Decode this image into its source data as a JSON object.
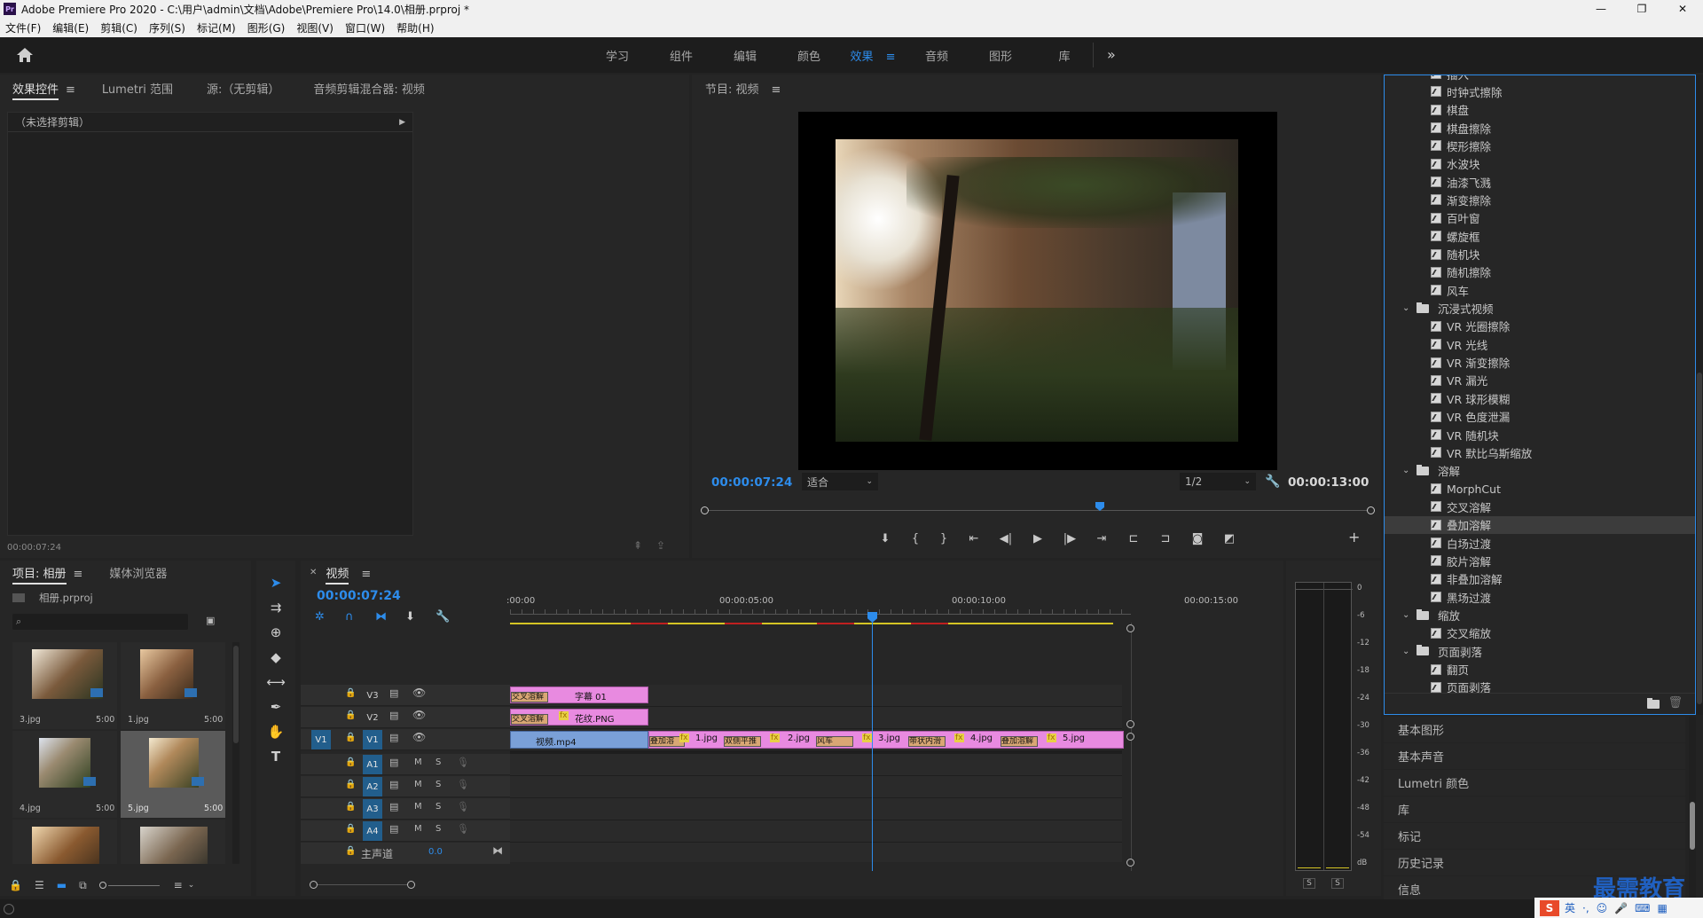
{
  "window": {
    "title": "Adobe Premiere Pro 2020 - C:\\用户\\admin\\文档\\Adobe\\Premiere Pro\\14.0\\相册.prproj *",
    "controls": [
      "—",
      "❐",
      "✕"
    ]
  },
  "menubar": [
    "文件(F)",
    "编辑(E)",
    "剪辑(C)",
    "序列(S)",
    "标记(M)",
    "图形(G)",
    "视图(V)",
    "窗口(W)",
    "帮助(H)"
  ],
  "workspaces": {
    "tabs": [
      "学习",
      "组件",
      "编辑",
      "颜色",
      "效果",
      "音频",
      "图形",
      "库"
    ],
    "active": "效果",
    "more": "»"
  },
  "effect_controls": {
    "tabs": [
      "效果控件",
      "Lumetri 范围",
      "源:（无剪辑）",
      "音频剪辑混合器: 视频"
    ],
    "no_clip": "（未选择剪辑）",
    "timecode": "00:00:07:24"
  },
  "program": {
    "title": "节目: 视频",
    "timecode": "00:00:07:24",
    "fit": "适合",
    "resolution": "1/2",
    "duration": "00:00:13:00"
  },
  "project": {
    "tabs": [
      "项目: 相册",
      "媒体浏览器"
    ],
    "file": "相册.prproj",
    "search_placeholder": "",
    "items": [
      {
        "name": "3.jpg",
        "duration": "5:00"
      },
      {
        "name": "1.jpg",
        "duration": "5:00"
      },
      {
        "name": "4.jpg",
        "duration": "5:00"
      },
      {
        "name": "5.jpg",
        "duration": "5:00"
      }
    ]
  },
  "timeline": {
    "tab": "视频",
    "timecode": "00:00:07:24",
    "ruler": [
      ":00:00",
      "00:00:05:00",
      "00:00:10:00",
      "00:00:15:00"
    ],
    "video_tracks": [
      {
        "name": "V3",
        "target": ""
      },
      {
        "name": "V2",
        "target": ""
      },
      {
        "name": "V1",
        "target": "V1"
      }
    ],
    "audio_tracks": [
      "A1",
      "A2",
      "A3",
      "A4"
    ],
    "master_label": "主声道",
    "master_value": "0.0",
    "mute": "M",
    "solo": "S",
    "clips": {
      "v3": [
        {
          "label": "交叉溶解"
        },
        {
          "label": "字幕 01"
        }
      ],
      "v2": [
        {
          "label": "交叉溶解"
        },
        {
          "label": "花纹.PNG"
        }
      ],
      "v1": [
        {
          "label": "视频.mp4"
        },
        {
          "label": "叠加溶"
        },
        {
          "label": "1.jpg"
        },
        {
          "label": "双侧平推"
        },
        {
          "label": "2.jpg"
        },
        {
          "label": "风车"
        },
        {
          "label": "3.jpg"
        },
        {
          "label": "带状内滑"
        },
        {
          "label": "4.jpg"
        },
        {
          "label": "叠加溶解"
        },
        {
          "label": "5.jpg"
        }
      ],
      "fx": "fx"
    }
  },
  "meter": {
    "scale": [
      "0",
      "-6",
      "-12",
      "-18",
      "-24",
      "-30",
      "-36",
      "-42",
      "-48",
      "-54",
      "dB"
    ],
    "solo_labels": [
      "S",
      "S"
    ]
  },
  "effects_tree": {
    "items": [
      {
        "kind": "effect",
        "label": "插入"
      },
      {
        "kind": "effect",
        "label": "时钟式擦除"
      },
      {
        "kind": "effect",
        "label": "棋盘"
      },
      {
        "kind": "effect",
        "label": "棋盘擦除"
      },
      {
        "kind": "effect",
        "label": "楔形擦除"
      },
      {
        "kind": "effect",
        "label": "水波块"
      },
      {
        "kind": "effect",
        "label": "油漆飞溅"
      },
      {
        "kind": "effect",
        "label": "渐变擦除"
      },
      {
        "kind": "effect",
        "label": "百叶窗"
      },
      {
        "kind": "effect",
        "label": "螺旋框"
      },
      {
        "kind": "effect",
        "label": "随机块"
      },
      {
        "kind": "effect",
        "label": "随机擦除"
      },
      {
        "kind": "effect",
        "label": "风车"
      },
      {
        "kind": "folder",
        "label": "沉浸式视频"
      },
      {
        "kind": "effect",
        "label": "VR 光圈擦除"
      },
      {
        "kind": "effect",
        "label": "VR 光线"
      },
      {
        "kind": "effect",
        "label": "VR 渐变擦除"
      },
      {
        "kind": "effect",
        "label": "VR 漏光"
      },
      {
        "kind": "effect",
        "label": "VR 球形模糊"
      },
      {
        "kind": "effect",
        "label": "VR 色度泄漏"
      },
      {
        "kind": "effect",
        "label": "VR 随机块"
      },
      {
        "kind": "effect",
        "label": "VR 默比乌斯缩放"
      },
      {
        "kind": "folder",
        "label": "溶解"
      },
      {
        "kind": "effect",
        "label": "MorphCut"
      },
      {
        "kind": "effect",
        "label": "交叉溶解"
      },
      {
        "kind": "effect",
        "label": "叠加溶解",
        "selected": true
      },
      {
        "kind": "effect",
        "label": "白场过渡"
      },
      {
        "kind": "effect",
        "label": "胶片溶解"
      },
      {
        "kind": "effect",
        "label": "非叠加溶解"
      },
      {
        "kind": "effect",
        "label": "黑场过渡"
      },
      {
        "kind": "folder",
        "label": "缩放"
      },
      {
        "kind": "effect",
        "label": "交叉缩放"
      },
      {
        "kind": "folder",
        "label": "页面剥落"
      },
      {
        "kind": "effect",
        "label": "翻页"
      },
      {
        "kind": "effect",
        "label": "页面剥落"
      }
    ]
  },
  "right_panels": [
    "基本图形",
    "基本声音",
    "Lumetri 颜色",
    "库",
    "标记",
    "历史记录",
    "信息"
  ],
  "watermark": "最需教育",
  "ime": "英"
}
